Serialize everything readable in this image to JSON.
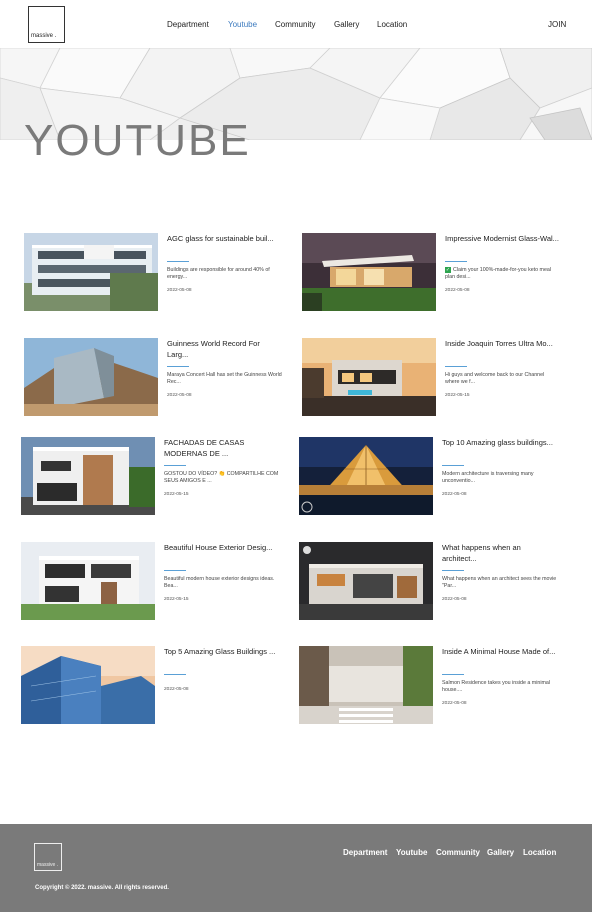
{
  "brand": {
    "logo_text": "massive ."
  },
  "nav": {
    "items": [
      "Department",
      "Youtube",
      "Community",
      "Gallery",
      "Location"
    ],
    "active": "Youtube",
    "join": "JOIN"
  },
  "hero": {
    "title": "YOUTUBE"
  },
  "videos": [
    {
      "title": "AGC glass for sustainable buil...",
      "desc": "Buildings are responsible for around 40% of energy...",
      "date": "2022-05-08"
    },
    {
      "title": "Impressive Modernist Glass-Wal...",
      "desc": "Claim your 100%-made-for-you keto meal plan desi...",
      "date": "2022-05-08",
      "check": true
    },
    {
      "title": "Guinness World Record For Larg...",
      "desc": "Maraya Concert Hall has set the Guinness World Rec...",
      "date": "2022-05-08"
    },
    {
      "title": "Inside Joaquin Torres Ultra Mo...",
      "desc": "Hi guys and welcome back to our Channel where we f...",
      "date": "2022-05-15"
    },
    {
      "title": "FACHADAS DE CASAS MODERNAS DE ...",
      "desc": "GOSTOU DO VÍDEO? 👏 COMPARTILHE COM SEUS AMIGOS E ...",
      "date": "2022-05-15"
    },
    {
      "title": "Top 10 Amazing glass buildings...",
      "desc": "Modern architecture is traversing many unconventio...",
      "date": "2022-05-08"
    },
    {
      "title": "Beautiful House Exterior Desig...",
      "desc": "Beautiful modern house exterior designs ideas. Bea...",
      "date": "2022-05-15"
    },
    {
      "title": "What happens when an architect...",
      "desc": "What happens when an architect sees the movie \"Par...",
      "date": "2022-05-08"
    },
    {
      "title": "Top 5 Amazing Glass Buildings ...",
      "desc": "",
      "date": "2022-05-08"
    },
    {
      "title": "Inside A Minimal House Made of...",
      "desc": "Salmon Residence takes you inside a minimal house....",
      "date": "2022-05-08"
    }
  ],
  "footer": {
    "nav": [
      "Department",
      "Youtube",
      "Community",
      "Gallery",
      "Location"
    ],
    "copyright": "Copyright © 2022. massive. All rights reserved."
  },
  "colors": {
    "accent": "#3d7bbf",
    "rule": "#5aa0d6",
    "footer_bg": "#7a7a7a"
  }
}
